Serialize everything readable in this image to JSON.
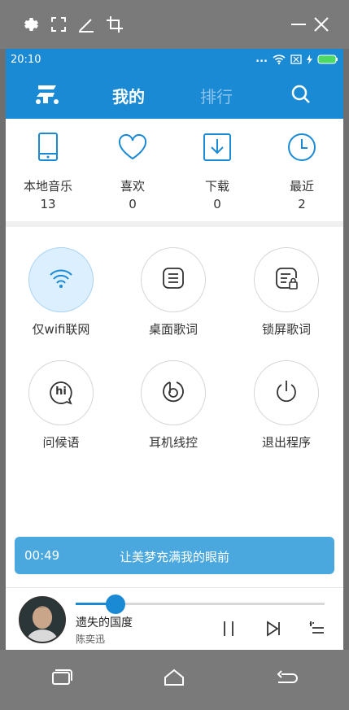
{
  "statusbar": {
    "time": "20:10",
    "dots": "..."
  },
  "appbar": {
    "tab_mine": "我的",
    "tab_rank": "排行"
  },
  "stats": [
    {
      "label": "本地音乐",
      "count": "13"
    },
    {
      "label": "喜欢",
      "count": "0"
    },
    {
      "label": "下载",
      "count": "0"
    },
    {
      "label": "最近",
      "count": "2"
    }
  ],
  "features": [
    {
      "label": "仅wifi联网",
      "active": true
    },
    {
      "label": "桌面歌词",
      "active": false
    },
    {
      "label": "锁屏歌词",
      "active": false
    },
    {
      "label": "问候语",
      "active": false
    },
    {
      "label": "耳机线控",
      "active": false
    },
    {
      "label": "退出程序",
      "active": false
    }
  ],
  "greeting_icon_text": "hi",
  "lyric": {
    "time": "00:49",
    "text": "让美梦充满我的眼前"
  },
  "player": {
    "title": "遗失的国度",
    "artist": "陈奕迅",
    "progress": 0.16
  },
  "colors": {
    "accent": "#1a8ad5",
    "lyric_bar": "#4aa8df",
    "active_circle": "#dcefff"
  }
}
